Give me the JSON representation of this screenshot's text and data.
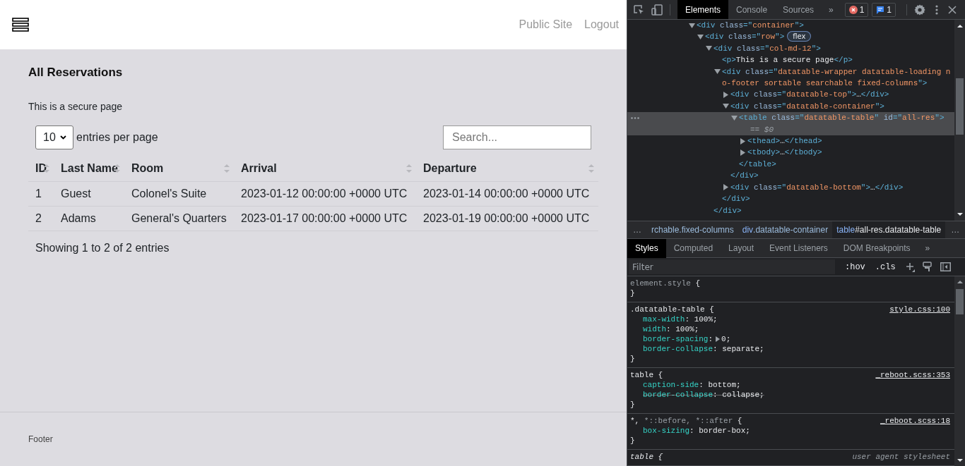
{
  "page": {
    "header": {
      "links": [
        "Public Site",
        "Logout"
      ]
    },
    "title": "All Reservations",
    "intro": "This is a secure page",
    "per_page": {
      "value": "10",
      "label": "entries per page"
    },
    "search": {
      "placeholder": "Search..."
    },
    "table": {
      "columns": [
        {
          "label": "ID",
          "sortable": true
        },
        {
          "label": "Last Name",
          "sortable": true
        },
        {
          "label": "Room",
          "sortable": true
        },
        {
          "label": "Arrival",
          "sortable": true
        },
        {
          "label": "Departure",
          "sortable": true
        }
      ],
      "rows": [
        [
          "1",
          "Guest",
          "Colonel's Suite",
          "2023-01-12 00:00:00 +0000 UTC",
          "2023-01-14 00:00:00 +0000 UTC"
        ],
        [
          "2",
          "Adams",
          "General's Quarters",
          "2023-01-17 00:00:00 +0000 UTC",
          "2023-01-19 00:00:00 +0000 UTC"
        ]
      ]
    },
    "info": "Showing 1 to 2 of 2 entries",
    "footer": "Footer"
  },
  "devtools": {
    "tabs": [
      {
        "label": "Elements",
        "selected": true
      },
      {
        "label": "Console",
        "selected": false
      },
      {
        "label": "Sources",
        "selected": false
      }
    ],
    "tabs_more": "»",
    "errors": "1",
    "messages": "1",
    "dom": [
      {
        "tokens": [
          {
            "kind": "tag",
            "text": "<div"
          },
          {
            "kind": "attr",
            "text": " class"
          },
          {
            "kind": "tag",
            "text": "=\""
          },
          {
            "kind": "value",
            "text": "container"
          },
          {
            "kind": "tag",
            "text": "\">"
          }
        ],
        "expanded": true,
        "selected": false,
        "children": [
          {
            "tokens": [
              {
                "kind": "tag",
                "text": "<div"
              },
              {
                "kind": "attr",
                "text": " class"
              },
              {
                "kind": "tag",
                "text": "=\""
              },
              {
                "kind": "value",
                "text": "row"
              },
              {
                "kind": "tag",
                "text": "\">"
              }
            ],
            "badge": "flex",
            "expanded": true,
            "selected": false,
            "children": [
              {
                "tokens": [
                  {
                    "kind": "tag",
                    "text": "<div"
                  },
                  {
                    "kind": "attr",
                    "text": " class"
                  },
                  {
                    "kind": "tag",
                    "text": "=\""
                  },
                  {
                    "kind": "value",
                    "text": "col-md-12"
                  },
                  {
                    "kind": "tag",
                    "text": "\">"
                  }
                ],
                "expanded": true,
                "selected": false,
                "close": [
                  {
                    "kind": "tag",
                    "text": "</div>"
                  }
                ],
                "children": [
                  {
                    "tokens": [
                      {
                        "kind": "tag",
                        "text": "<p>"
                      },
                      {
                        "kind": "text",
                        "text": "This is a secure page"
                      },
                      {
                        "kind": "tag",
                        "text": "</p>"
                      }
                    ],
                    "selected": false
                  },
                  {
                    "tokens": [
                      {
                        "kind": "tag",
                        "text": "<div"
                      },
                      {
                        "kind": "attr",
                        "text": " class"
                      },
                      {
                        "kind": "tag",
                        "text": "=\""
                      },
                      {
                        "kind": "value",
                        "text": "datatable-wrapper datatable-loading no-footer sortable searchable fixed-columns"
                      },
                      {
                        "kind": "tag",
                        "text": "\">"
                      }
                    ],
                    "expanded": true,
                    "selected": false,
                    "close": [
                      {
                        "kind": "tag",
                        "text": "</div>"
                      }
                    ],
                    "children": [
                      {
                        "tokens": [
                          {
                            "kind": "tag",
                            "text": "<div"
                          },
                          {
                            "kind": "attr",
                            "text": " class"
                          },
                          {
                            "kind": "tag",
                            "text": "=\""
                          },
                          {
                            "kind": "value",
                            "text": "datatable-top"
                          },
                          {
                            "kind": "tag",
                            "text": "\">"
                          },
                          {
                            "kind": "text",
                            "text": "…"
                          },
                          {
                            "kind": "tag",
                            "text": "</div>"
                          }
                        ],
                        "expanded": false,
                        "selected": false
                      },
                      {
                        "tokens": [
                          {
                            "kind": "tag",
                            "text": "<div"
                          },
                          {
                            "kind": "attr",
                            "text": " class"
                          },
                          {
                            "kind": "tag",
                            "text": "=\""
                          },
                          {
                            "kind": "value",
                            "text": "datatable-container"
                          },
                          {
                            "kind": "tag",
                            "text": "\">"
                          }
                        ],
                        "expanded": true,
                        "selected": false,
                        "close": [
                          {
                            "kind": "tag",
                            "text": "</div>"
                          }
                        ],
                        "children": [
                          {
                            "tokens": [
                              {
                                "kind": "tag",
                                "text": "<table"
                              },
                              {
                                "kind": "attr",
                                "text": " class"
                              },
                              {
                                "kind": "tag",
                                "text": "=\""
                              },
                              {
                                "kind": "value",
                                "text": "datatable-table"
                              },
                              {
                                "kind": "tag",
                                "text": "\""
                              },
                              {
                                "kind": "attr",
                                "text": " id"
                              },
                              {
                                "kind": "tag",
                                "text": "=\""
                              },
                              {
                                "kind": "value",
                                "text": "all-res"
                              },
                              {
                                "kind": "tag",
                                "text": "\">"
                              }
                            ],
                            "note": "== $0",
                            "expanded": true,
                            "selected": true,
                            "close": [
                              {
                                "kind": "tag",
                                "text": "</table>"
                              }
                            ],
                            "children": [
                              {
                                "tokens": [
                                  {
                                    "kind": "tag",
                                    "text": "<thead>"
                                  },
                                  {
                                    "kind": "text",
                                    "text": "…"
                                  },
                                  {
                                    "kind": "tag",
                                    "text": "</thead>"
                                  }
                                ],
                                "expanded": false,
                                "selected": false
                              },
                              {
                                "tokens": [
                                  {
                                    "kind": "tag",
                                    "text": "<tbody>"
                                  },
                                  {
                                    "kind": "text",
                                    "text": "…"
                                  },
                                  {
                                    "kind": "tag",
                                    "text": "</tbody>"
                                  }
                                ],
                                "expanded": false,
                                "selected": false
                              }
                            ]
                          }
                        ]
                      },
                      {
                        "tokens": [
                          {
                            "kind": "tag",
                            "text": "<div"
                          },
                          {
                            "kind": "attr",
                            "text": " class"
                          },
                          {
                            "kind": "tag",
                            "text": "=\""
                          },
                          {
                            "kind": "value",
                            "text": "datatable-bottom"
                          },
                          {
                            "kind": "tag",
                            "text": "\">"
                          },
                          {
                            "kind": "text",
                            "text": "…"
                          },
                          {
                            "kind": "tag",
                            "text": "</div>"
                          }
                        ],
                        "expanded": false,
                        "selected": false
                      }
                    ]
                  }
                ]
              }
            ]
          }
        ]
      }
    ],
    "crumbs_more_left": "…",
    "breadcrumbs": [
      {
        "rest": "rchable.fixed-columns",
        "selected": false
      },
      {
        "tag": "div",
        "rest": ".datatable-container",
        "selected": false
      },
      {
        "tag": "table",
        "rest": "#all-res.datatable-table",
        "selected": true
      }
    ],
    "crumbs_more_right": "…",
    "styles_tabs": [
      {
        "label": "Styles",
        "selected": true
      },
      {
        "label": "Computed",
        "selected": false
      },
      {
        "label": "Layout",
        "selected": false
      },
      {
        "label": "Event Listeners",
        "selected": false
      },
      {
        "label": "DOM Breakpoints",
        "selected": false
      }
    ],
    "styles_more": "»",
    "filter": {
      "placeholder": "Filter"
    },
    "toggles": [
      ":hov",
      ".cls"
    ],
    "rules": [
      {
        "kind": "inline",
        "selector": [
          {
            "text": "element.style",
            "dim": true
          }
        ],
        "open": "{",
        "close": "}"
      },
      {
        "kind": "author",
        "selector": [
          {
            "text": ".datatable-table",
            "dim": false
          }
        ],
        "open": "{",
        "close": "}",
        "source": "style.css:100",
        "decls": [
          {
            "property": "max-width",
            "colon": ":",
            "value": "100%;",
            "struck": false
          },
          {
            "property": "width",
            "colon": ":",
            "value": "100%;",
            "struck": false
          },
          {
            "property": "border-spacing",
            "colon": ":",
            "value": "0;",
            "struck": false,
            "expandable": true
          },
          {
            "property": "border-collapse",
            "colon": ":",
            "value": "separate;",
            "struck": false
          }
        ]
      },
      {
        "kind": "author",
        "selector": [
          {
            "text": "table",
            "dim": false
          }
        ],
        "open": "{",
        "close": "}",
        "source": "_reboot.scss:353",
        "decls": [
          {
            "property": "caption-side",
            "colon": ":",
            "value": "bottom;",
            "struck": false
          },
          {
            "property": "border-collapse",
            "colon": ":",
            "value": "collapse;",
            "struck": true
          }
        ]
      },
      {
        "kind": "author",
        "selector": [
          {
            "text": "*, ",
            "dim": false
          },
          {
            "text": "*::before, *::after",
            "dim": true
          }
        ],
        "open": "{",
        "close": "}",
        "source": "_reboot.scss:18",
        "decls": [
          {
            "property": "box-sizing",
            "colon": ":",
            "value": "border-box;",
            "struck": false
          }
        ]
      },
      {
        "kind": "user-agent",
        "selector": [
          {
            "text": "table",
            "dim": false
          }
        ],
        "open": "{",
        "source": "user agent stylesheet"
      }
    ]
  }
}
